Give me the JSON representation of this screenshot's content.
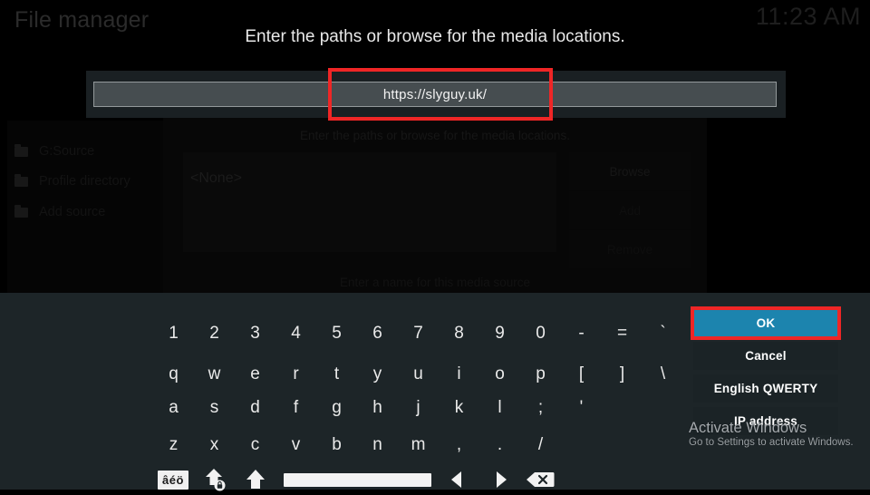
{
  "window": {
    "title": "File manager",
    "clock": "11:23 AM"
  },
  "sidebar": {
    "items": [
      {
        "label": "G:Source",
        "icon": "folder-icon"
      },
      {
        "label": "Profile directory",
        "icon": "folder-icon"
      },
      {
        "label": "Add source",
        "icon": "folder-icon"
      }
    ]
  },
  "background_dialog": {
    "heading": "Enter the paths or browse for the media locations.",
    "list_value": "<None>",
    "buttons": [
      "Browse",
      "Add",
      "Remove"
    ],
    "footer": "Enter a name for this media source"
  },
  "entry": {
    "heading": "Enter the paths or browse for the media locations.",
    "value": "https://slyguy.uk/",
    "placeholder": ""
  },
  "keyboard": {
    "rows": [
      [
        "1",
        "2",
        "3",
        "4",
        "5",
        "6",
        "7",
        "8",
        "9",
        "0",
        "-",
        "=",
        "`"
      ],
      [
        "q",
        "w",
        "e",
        "r",
        "t",
        "y",
        "u",
        "i",
        "o",
        "p",
        "[",
        "]",
        "\\"
      ],
      [
        "a",
        "s",
        "d",
        "f",
        "g",
        "h",
        "j",
        "k",
        "l",
        ";",
        "'"
      ],
      [
        "z",
        "x",
        "c",
        "v",
        "b",
        "n",
        "m",
        ",",
        ".",
        "/"
      ]
    ],
    "function_row": [
      {
        "name": "accents-key",
        "label": "âéö"
      },
      {
        "name": "caps-lock-key",
        "label": ""
      },
      {
        "name": "shift-key",
        "label": ""
      },
      {
        "name": "space-key",
        "label": ""
      },
      {
        "name": "cursor-left-key",
        "label": ""
      },
      {
        "name": "cursor-right-key",
        "label": ""
      },
      {
        "name": "backspace-key",
        "label": ""
      }
    ]
  },
  "side_buttons": [
    {
      "label": "OK",
      "primary": true,
      "highlighted": true
    },
    {
      "label": "Cancel",
      "primary": false,
      "highlighted": false
    },
    {
      "label": "English QWERTY",
      "primary": false,
      "highlighted": false
    },
    {
      "label": "IP address",
      "primary": false,
      "highlighted": false
    }
  ],
  "watermark": {
    "line1": "Activate Windows",
    "line2": "Go to Settings to activate Windows."
  },
  "colors": {
    "accent": "#1c84ae",
    "highlight": "#ef2626",
    "keyboard_bg": "#1d2528",
    "field_bg": "#464d50"
  }
}
